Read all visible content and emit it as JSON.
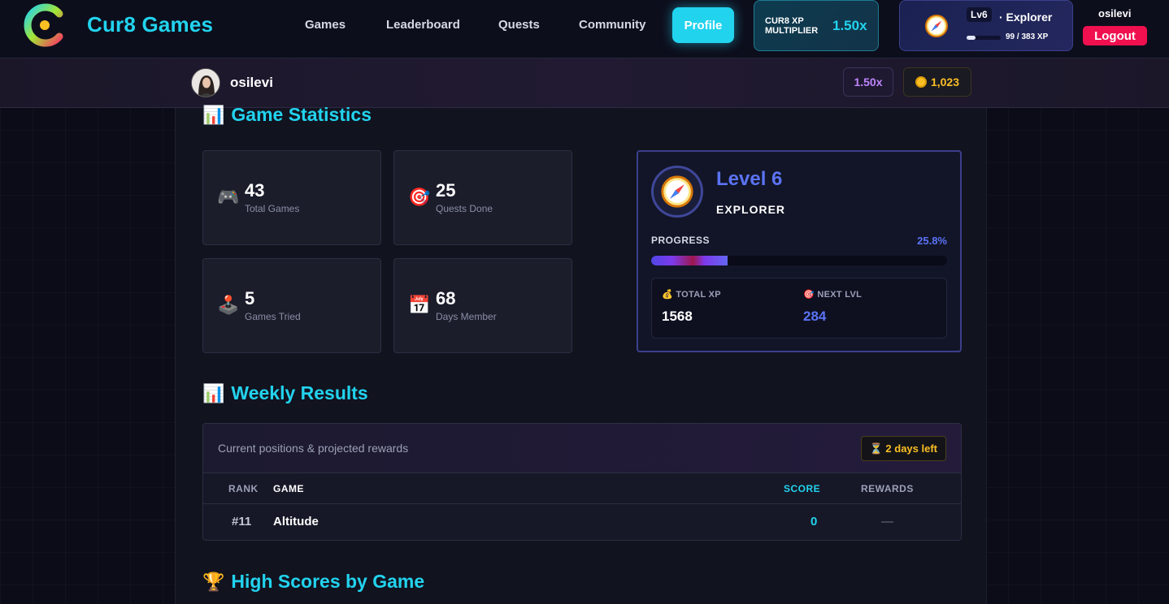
{
  "nav": {
    "brand": "Cur8 Games",
    "links": [
      "Games",
      "Leaderboard",
      "Quests",
      "Community"
    ],
    "profile_label": "Profile",
    "multiplier_label": "CUR8 XP MULTIPLIER",
    "multiplier_value": "1.50x",
    "level_pill": "Lv6",
    "level_title": "· Explorer",
    "level_xp": "99 / 383 XP",
    "level_progress": 0.258,
    "username": "osilevi",
    "logout_label": "Logout"
  },
  "subbar": {
    "username": "osilevi",
    "multiplier": "1.50x",
    "coins": "1,023"
  },
  "stats": {
    "title": "Game Statistics",
    "cards": [
      {
        "icon": "gamepad-icon",
        "glyph": "🎮",
        "value": "43",
        "label": "Total Games"
      },
      {
        "icon": "target-icon",
        "glyph": "🎯",
        "value": "25",
        "label": "Quests Done"
      },
      {
        "icon": "joystick-icon",
        "glyph": "🕹️",
        "value": "5",
        "label": "Games Tried"
      },
      {
        "icon": "calendar-icon",
        "glyph": "📅",
        "value": "68",
        "label": "Days Member"
      }
    ]
  },
  "level": {
    "title": "Level 6",
    "rank": "EXPLORER",
    "progress_label": "PROGRESS",
    "progress_pct": "25.8%",
    "total_xp_label": "💰 TOTAL XP",
    "total_xp": "1568",
    "next_lvl_label": "🎯 NEXT LVL",
    "next_lvl": "284"
  },
  "weekly": {
    "title": "Weekly Results",
    "subtitle": "Current positions & projected rewards",
    "days_left": "⏳ 2 days left",
    "columns": [
      "RANK",
      "GAME",
      "SCORE",
      "REWARDS"
    ],
    "rows": [
      {
        "rank": "#11",
        "game": "Altitude",
        "score": "0",
        "rewards": "—"
      }
    ]
  },
  "highscores": {
    "title": "High Scores by Game"
  },
  "colors": {
    "accent": "#22d3ee",
    "level_blue": "#5b73f5",
    "logout": "#f0104f",
    "coin": "#fbbf24"
  }
}
